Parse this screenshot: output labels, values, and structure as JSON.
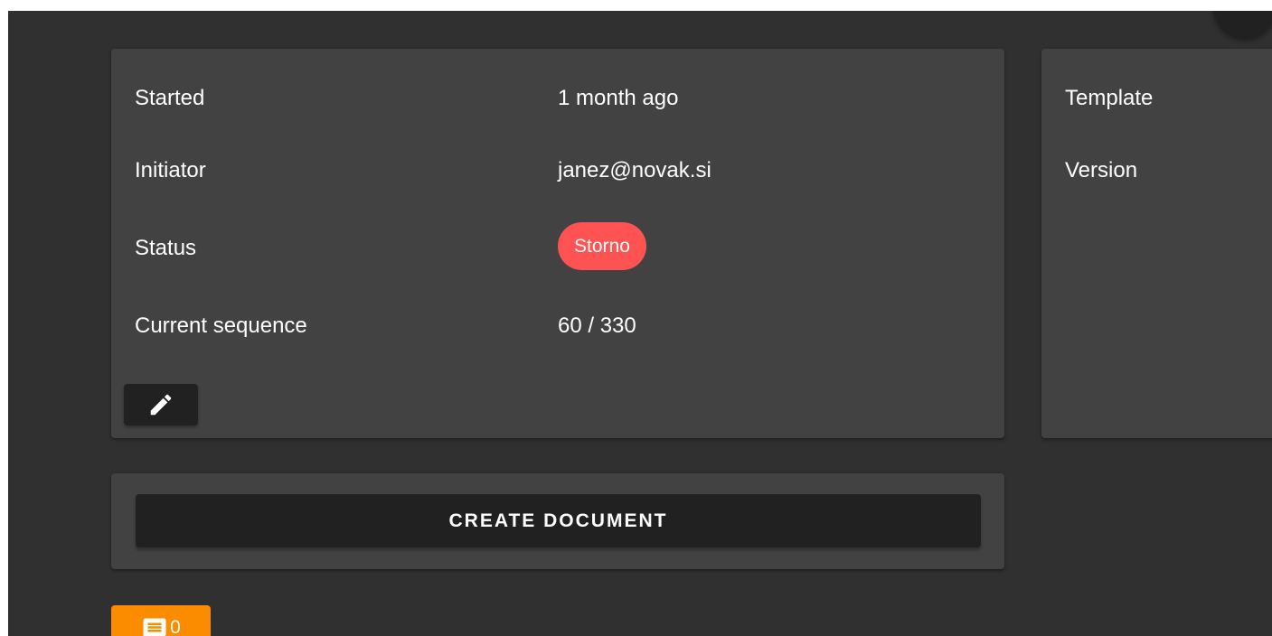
{
  "process": {
    "rows": [
      {
        "label": "Started",
        "value": "1 month ago"
      },
      {
        "label": "Initiator",
        "value": "janez@novak.si"
      },
      {
        "label": "Status",
        "value": "Storno"
      },
      {
        "label": "Current sequence",
        "value": "60 / 330"
      }
    ],
    "status_color": "#ff5252"
  },
  "side": {
    "labels": [
      "Template",
      "Version"
    ]
  },
  "actions": {
    "create_label": "CREATE DOCUMENT"
  },
  "comments": {
    "count": "0",
    "accent": "#fb8c00"
  },
  "icons": {
    "edit": "pencil-icon",
    "comments": "comment-icon"
  }
}
